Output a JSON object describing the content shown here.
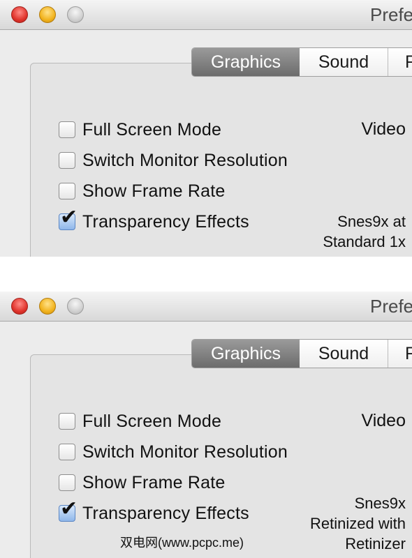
{
  "windows": [
    {
      "title": "Prefe",
      "tabs": [
        "Graphics",
        "Sound",
        "F"
      ],
      "active_tab": "Graphics",
      "options": [
        {
          "label": "Full Screen Mode",
          "checked": false
        },
        {
          "label": "Switch Monitor Resolution",
          "checked": false
        },
        {
          "label": "Show Frame Rate",
          "checked": false
        },
        {
          "label": "Transparency Effects",
          "checked": true
        }
      ],
      "video_heading": "Video",
      "video_text": [
        "Snes9x at",
        "Standard 1x"
      ]
    },
    {
      "title": "Prefe",
      "tabs": [
        "Graphics",
        "Sound",
        "F"
      ],
      "active_tab": "Graphics",
      "options": [
        {
          "label": "Full Screen Mode",
          "checked": false
        },
        {
          "label": "Switch Monitor Resolution",
          "checked": false
        },
        {
          "label": "Show Frame Rate",
          "checked": false
        },
        {
          "label": "Transparency Effects",
          "checked": true
        }
      ],
      "video_heading": "Video",
      "video_text": [
        "Snes9x",
        "Retinized with",
        "Retinizer"
      ]
    }
  ],
  "checkmark_glyph": "✔",
  "watermark": "双电网(www.pcpc.me)"
}
